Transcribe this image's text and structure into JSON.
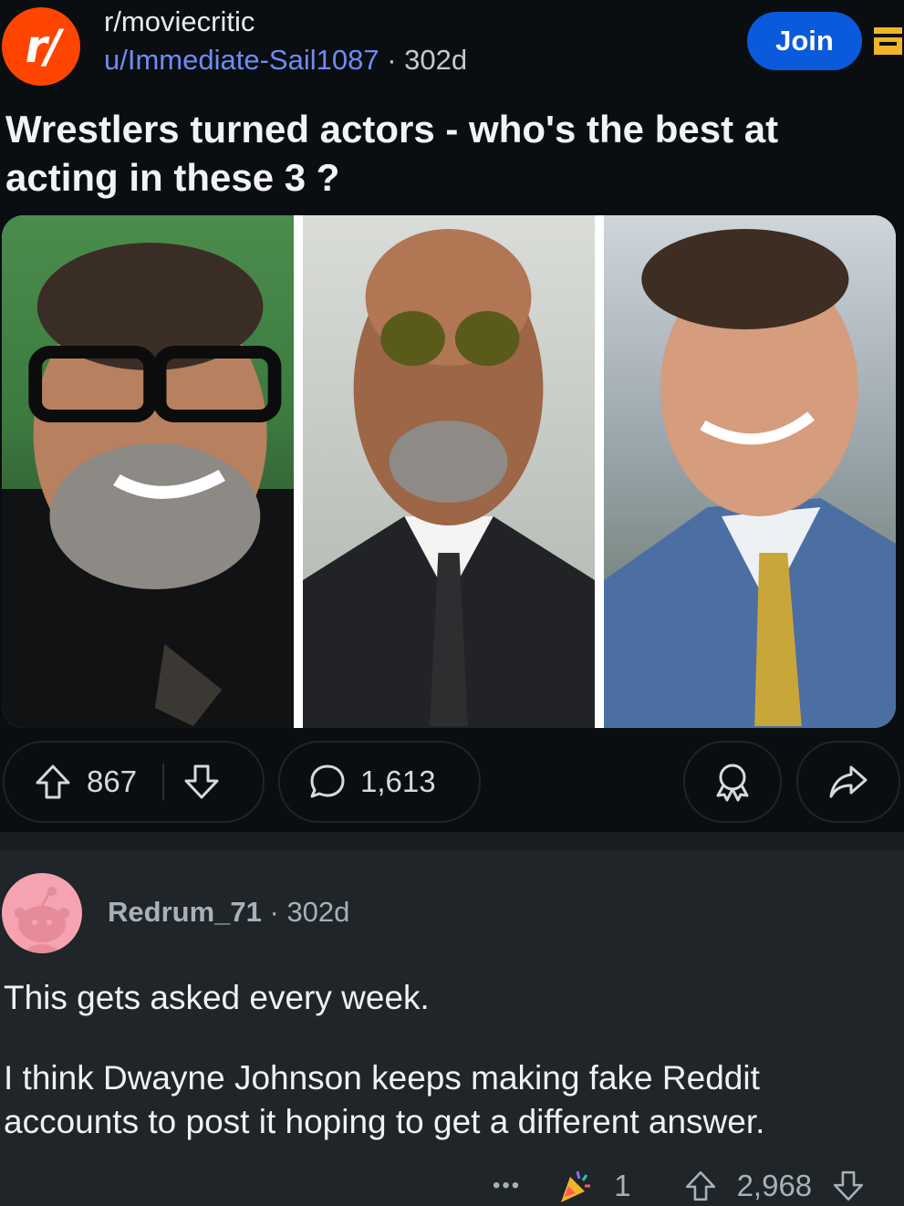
{
  "post": {
    "subreddit": "r/moviecritic",
    "subreddit_icon_text": "r/",
    "author": "u/Immediate-Sail1087",
    "separator": "·",
    "age": "302d",
    "join_label": "Join",
    "title": "Wrestlers turned actors - who's the best at acting in these 3 ?",
    "upvotes": "867",
    "comments": "1,613"
  },
  "comment": {
    "username": "Redrum_71",
    "separator": "·",
    "age": "302d",
    "line1": "This gets asked every week.",
    "line2": "I think Dwayne Johnson keeps making fake Reddit accounts to post it hoping to get a different answer.",
    "more": "•••",
    "awards": "1",
    "upvotes": "2,968"
  },
  "colors": {
    "background": "#0b0e11",
    "accent": "#ff4500",
    "join": "#0a5adb",
    "author_link": "#6e8cf3",
    "comment_bg": "#1f2528"
  }
}
